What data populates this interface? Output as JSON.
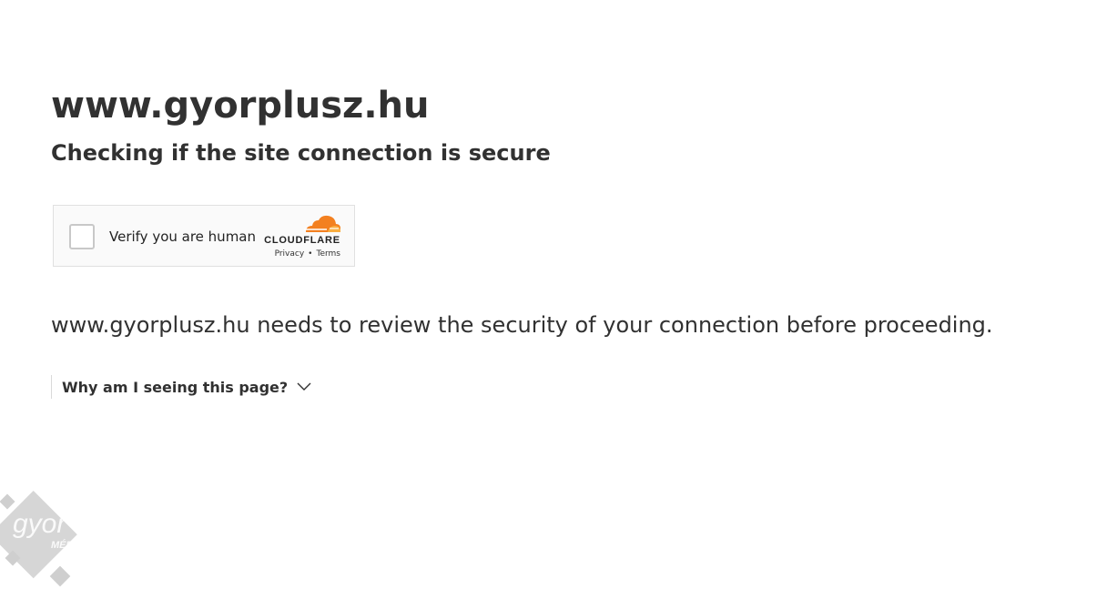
{
  "page": {
    "title": "www.gyorplusz.hu",
    "subtitle": "Checking if the site connection is secure",
    "message": "www.gyorplusz.hu needs to review the security of your connection before proceeding.",
    "why_label": "Why am I seeing this page?"
  },
  "challenge": {
    "checkbox_label": "Verify you are human",
    "brand": "CLOUDFLARE",
    "privacy_link": "Privacy",
    "separator": "•",
    "terms_link": "Terms",
    "brand_color": "#f38020"
  },
  "icons": {
    "chevron": "chevron-down-icon",
    "cloud": "cloudflare-cloud-icon",
    "watermark": "gyor-plusz-media-logo"
  },
  "watermark": {
    "brand_text": "gyor+",
    "sub_text": "MÉDIA"
  }
}
